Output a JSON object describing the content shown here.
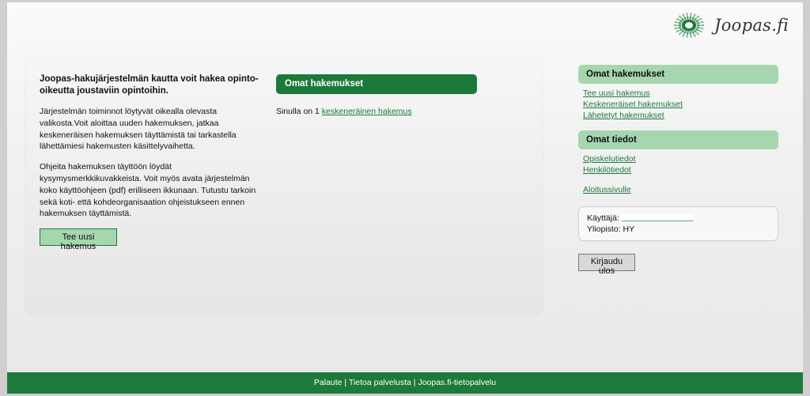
{
  "logo": {
    "text": "Joopas.fi",
    "icon": "joopas-starburst-logo"
  },
  "intro": {
    "heading": "Joopas-hakujärjestelmän kautta voit hakea opinto-oikeutta joustaviin opintoihin.",
    "paragraph1": "Järjestelmän toiminnot löytyvät oikealla olevasta valikosta.Voit aloittaa uuden hakemuksen, jatkaa keskeneräisen hakemuksen täyttämistä tai tarkastella lähettämiesi hakemusten käsittelyvaihetta.",
    "paragraph2": "Ohjeita hakemuksen täyttöön löydät kysymysmerkkikuvakkeista. Voit myös avata järjestelmän koko käyttöohjeen (pdf) erilliseen ikkunaan. Tutustu tarkoin sekä koti- että kohdeorganisaation ohjeistukseen ennen hakemuksen täyttämistä.",
    "new_application_button": "Tee uusi hakemus"
  },
  "applications": {
    "header": "Omat hakemukset",
    "status_prefix": "Sinulla on 1",
    "status_link": "keskeneräinen hakemus"
  },
  "sidebar": {
    "applications_header": "Omat hakemukset",
    "application_links": [
      "Tee uusi hakemus",
      "Keskeneräiset hakemukset",
      "Lähetetyt hakemukset"
    ],
    "info_header": "Omat tiedot",
    "info_links": [
      "Opiskelutiedot",
      "Henkilötiedot"
    ],
    "home_link": "Aloitussivulle",
    "user_label": "Käyttäjä:",
    "university_label": "Yliopisto:",
    "university_value": "HY",
    "logout_button": "Kirjaudu ulos"
  },
  "footer": {
    "links": [
      "Palaute",
      "Tietoa palvelusta",
      "Joopas.fi-tietopalvelu"
    ],
    "separator": " | "
  },
  "colors": {
    "brand_green": "#1d7a3a",
    "light_green": "#a5d6b0"
  }
}
